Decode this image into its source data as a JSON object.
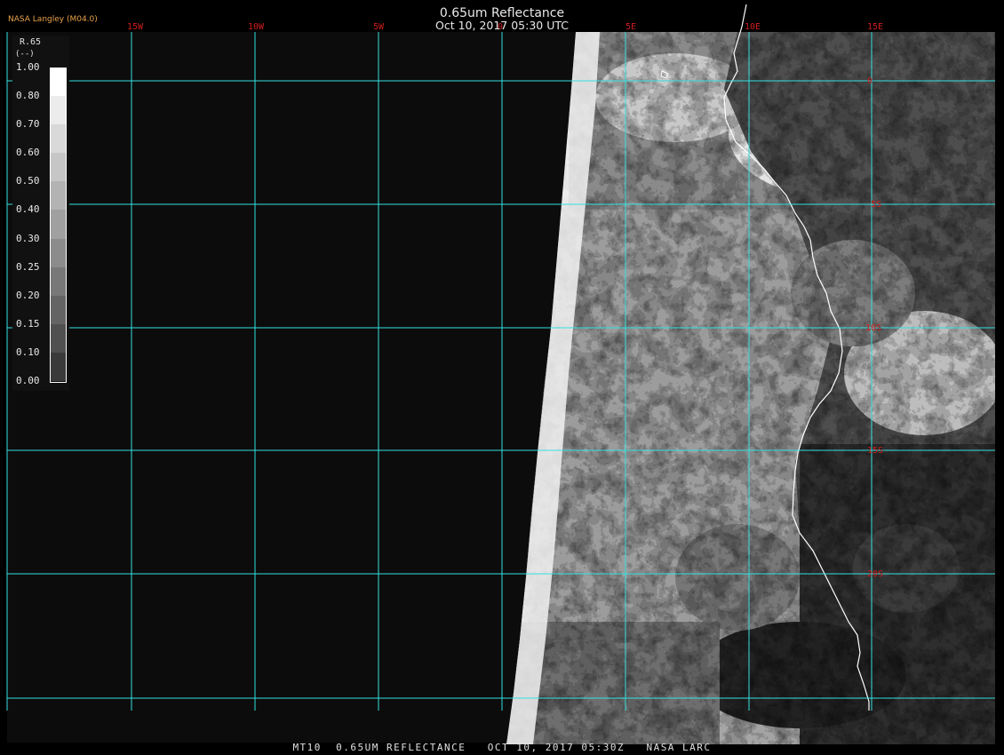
{
  "header": {
    "product": "0.65um Reflectance",
    "datetime": "Oct 10, 2017 05:30 UTC",
    "organization": "NASA Langley (M04.0)"
  },
  "footer": {
    "text": "MT10  0.65UM REFLECTANCE   OCT 10, 2017 05:30Z   NASA LARC"
  },
  "legend": {
    "variable": "R.65",
    "unit": "(--)",
    "ticks": [
      "1.00",
      "0.80",
      "0.70",
      "0.60",
      "0.50",
      "0.40",
      "0.30",
      "0.25",
      "0.20",
      "0.15",
      "0.10",
      "0.00"
    ],
    "shades": [
      "#ffffff",
      "#ececec",
      "#d9d9d9",
      "#c6c6c6",
      "#b3b3b3",
      "#a0a0a0",
      "#8c8c8c",
      "#787878",
      "#646464",
      "#505050",
      "#3a3a3a",
      "#1f1f1f"
    ]
  },
  "grid": {
    "line_color": "#35e0e0",
    "label_color": "#d01e1e",
    "lon_labels": [
      "15W",
      "10W",
      "5W",
      "0",
      "5E",
      "10E",
      "15E"
    ],
    "lat_labels": [
      "0",
      "5S",
      "10S",
      "15S",
      "20S"
    ]
  },
  "colors": {
    "background": "#000000",
    "space": "#0c0c0c",
    "coast": "#ffffff"
  }
}
